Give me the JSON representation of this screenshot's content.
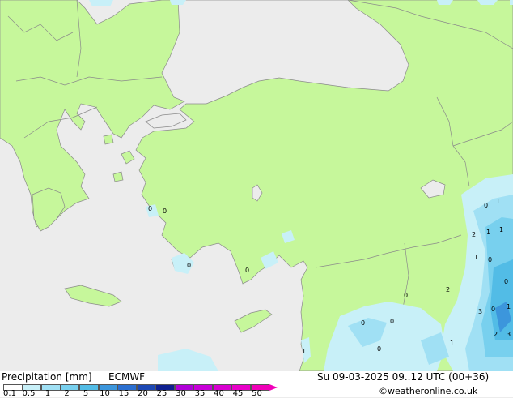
{
  "title": "Precipitation [mm]",
  "model": "ECMWF",
  "valid_time": "Su 09-03-2025 09..12 UTC (00+36)",
  "credit": "©weatheronline.co.uk",
  "legend": {
    "ticks": [
      "0.1",
      "0.5",
      "1",
      "2",
      "5",
      "10",
      "15",
      "20",
      "25",
      "30",
      "35",
      "40",
      "45",
      "50"
    ],
    "colors": [
      "#fefefe",
      "#c8f0f8",
      "#a0e0f4",
      "#78d0ee",
      "#52bce6",
      "#3c96dc",
      "#2b6fd0",
      "#1c48b4",
      "#0e2090",
      "#b000d8",
      "#c800d8",
      "#d800d0",
      "#e800c8",
      "#f000b8"
    ]
  },
  "map_labels": {
    "n1": "0",
    "n2": "0",
    "n3": "0",
    "n4": "1",
    "n5": "1",
    "n6": "1",
    "n7": "2",
    "n8": "1",
    "n9": "0",
    "n10": "2",
    "n11": "0",
    "n12": "3",
    "n13": "0",
    "n14": "1",
    "n15": "2",
    "n16": "3",
    "n17": "0",
    "n18": "0",
    "n19": "0",
    "n20": "0",
    "n21": "0",
    "n22": "1",
    "n23": "1",
    "n24": "0"
  }
}
